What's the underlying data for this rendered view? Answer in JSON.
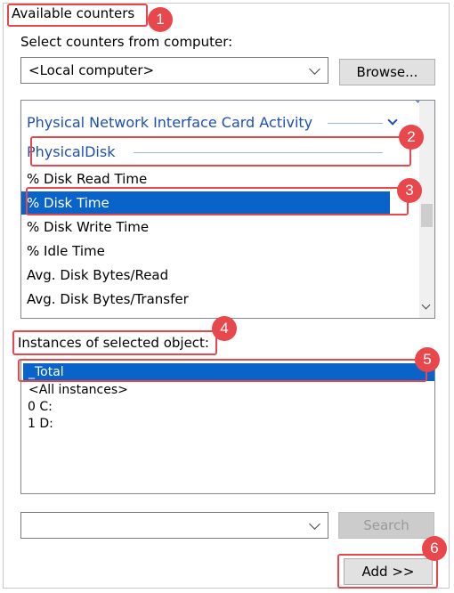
{
  "available_counters": {
    "title": "Available counters"
  },
  "computer": {
    "label": "Select counters from computer:",
    "value": "<Local computer>",
    "browse_label": "Browse..."
  },
  "counters": {
    "groups": [
      {
        "label": "Physical Network Interface Card Activity",
        "expanded": false
      },
      {
        "label": "PhysicalDisk",
        "expanded": true
      }
    ],
    "items": [
      "% Disk Read Time",
      "% Disk Time",
      "% Disk Write Time",
      "% Idle Time",
      "Avg. Disk Bytes/Read",
      "Avg. Disk Bytes/Transfer"
    ],
    "selected_item": "% Disk Time"
  },
  "instances": {
    "label": "Instances of selected object:",
    "items": [
      "_Total",
      "<All instances>",
      "0 C:",
      "1 D:"
    ],
    "selected": "_Total"
  },
  "search": {
    "value": "",
    "button_label": "Search"
  },
  "add": {
    "label": "Add >>"
  },
  "callouts": [
    "1",
    "2",
    "3",
    "4",
    "5",
    "6"
  ],
  "colors": {
    "accent": "#0a63c9",
    "group_text": "#1f4fb0",
    "highlight": "#e8474b"
  }
}
